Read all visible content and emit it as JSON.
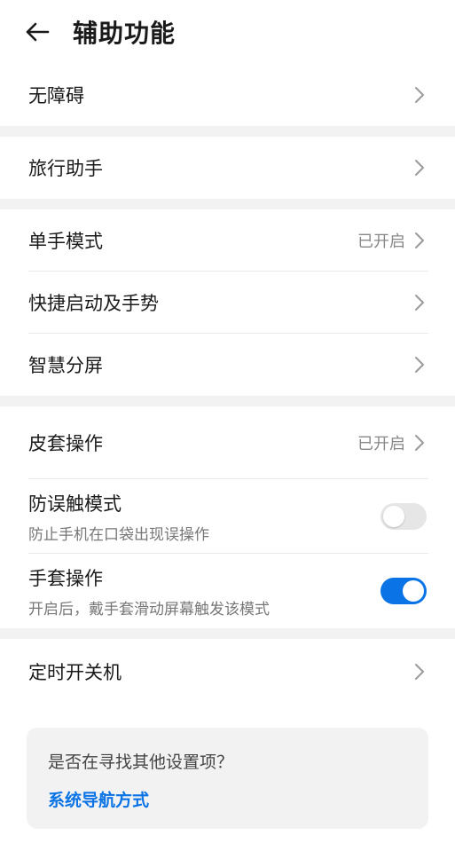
{
  "header": {
    "title": "辅助功能",
    "back_icon": "arrow-left-icon"
  },
  "groups": [
    [
      {
        "id": "accessibility",
        "label": "无障碍",
        "type": "nav"
      }
    ],
    [
      {
        "id": "travel-assistant",
        "label": "旅行助手",
        "type": "nav"
      }
    ],
    [
      {
        "id": "one-hand-mode",
        "label": "单手模式",
        "status": "已开启",
        "type": "nav"
      },
      {
        "id": "quick-launch",
        "label": "快捷启动及手势",
        "type": "nav"
      },
      {
        "id": "smart-split",
        "label": "智慧分屏",
        "type": "nav"
      }
    ],
    [
      {
        "id": "cover-operation",
        "label": "皮套操作",
        "status": "已开启",
        "type": "nav"
      },
      {
        "id": "accidental-touch",
        "label": "防误触模式",
        "sub": "防止手机在口袋出现误操作",
        "type": "toggle",
        "on": false
      },
      {
        "id": "glove-mode",
        "label": "手套操作",
        "sub": "开启后，戴手套滑动屏幕触发该模式",
        "type": "toggle",
        "on": true
      }
    ],
    [
      {
        "id": "scheduled-power",
        "label": "定时开关机",
        "type": "nav"
      }
    ]
  ],
  "suggestion": {
    "question": "是否在寻找其他设置项？",
    "link": "系统导航方式"
  },
  "colors": {
    "accent": "#0a73e6",
    "separator": "#f2f2f2"
  }
}
